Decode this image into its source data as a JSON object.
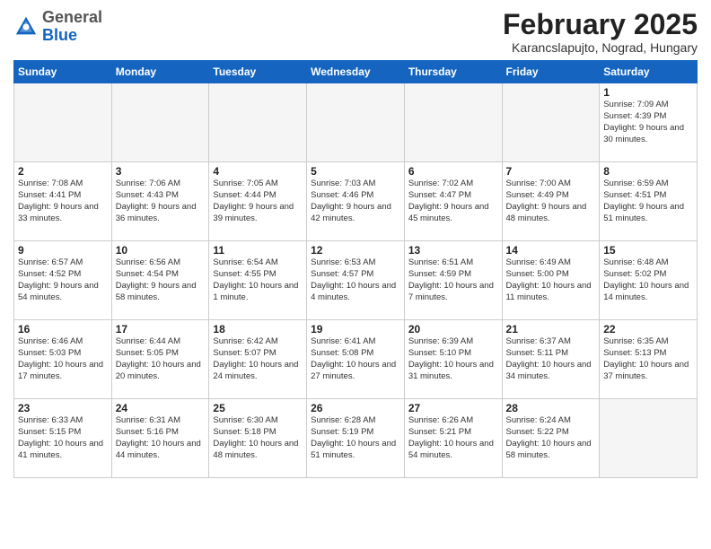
{
  "header": {
    "logo_general": "General",
    "logo_blue": "Blue",
    "month_title": "February 2025",
    "subtitle": "Karancslapujto, Nograd, Hungary"
  },
  "weekdays": [
    "Sunday",
    "Monday",
    "Tuesday",
    "Wednesday",
    "Thursday",
    "Friday",
    "Saturday"
  ],
  "weeks": [
    [
      {
        "day": "",
        "info": ""
      },
      {
        "day": "",
        "info": ""
      },
      {
        "day": "",
        "info": ""
      },
      {
        "day": "",
        "info": ""
      },
      {
        "day": "",
        "info": ""
      },
      {
        "day": "",
        "info": ""
      },
      {
        "day": "1",
        "info": "Sunrise: 7:09 AM\nSunset: 4:39 PM\nDaylight: 9 hours and 30 minutes."
      }
    ],
    [
      {
        "day": "2",
        "info": "Sunrise: 7:08 AM\nSunset: 4:41 PM\nDaylight: 9 hours and 33 minutes."
      },
      {
        "day": "3",
        "info": "Sunrise: 7:06 AM\nSunset: 4:43 PM\nDaylight: 9 hours and 36 minutes."
      },
      {
        "day": "4",
        "info": "Sunrise: 7:05 AM\nSunset: 4:44 PM\nDaylight: 9 hours and 39 minutes."
      },
      {
        "day": "5",
        "info": "Sunrise: 7:03 AM\nSunset: 4:46 PM\nDaylight: 9 hours and 42 minutes."
      },
      {
        "day": "6",
        "info": "Sunrise: 7:02 AM\nSunset: 4:47 PM\nDaylight: 9 hours and 45 minutes."
      },
      {
        "day": "7",
        "info": "Sunrise: 7:00 AM\nSunset: 4:49 PM\nDaylight: 9 hours and 48 minutes."
      },
      {
        "day": "8",
        "info": "Sunrise: 6:59 AM\nSunset: 4:51 PM\nDaylight: 9 hours and 51 minutes."
      }
    ],
    [
      {
        "day": "9",
        "info": "Sunrise: 6:57 AM\nSunset: 4:52 PM\nDaylight: 9 hours and 54 minutes."
      },
      {
        "day": "10",
        "info": "Sunrise: 6:56 AM\nSunset: 4:54 PM\nDaylight: 9 hours and 58 minutes."
      },
      {
        "day": "11",
        "info": "Sunrise: 6:54 AM\nSunset: 4:55 PM\nDaylight: 10 hours and 1 minute."
      },
      {
        "day": "12",
        "info": "Sunrise: 6:53 AM\nSunset: 4:57 PM\nDaylight: 10 hours and 4 minutes."
      },
      {
        "day": "13",
        "info": "Sunrise: 6:51 AM\nSunset: 4:59 PM\nDaylight: 10 hours and 7 minutes."
      },
      {
        "day": "14",
        "info": "Sunrise: 6:49 AM\nSunset: 5:00 PM\nDaylight: 10 hours and 11 minutes."
      },
      {
        "day": "15",
        "info": "Sunrise: 6:48 AM\nSunset: 5:02 PM\nDaylight: 10 hours and 14 minutes."
      }
    ],
    [
      {
        "day": "16",
        "info": "Sunrise: 6:46 AM\nSunset: 5:03 PM\nDaylight: 10 hours and 17 minutes."
      },
      {
        "day": "17",
        "info": "Sunrise: 6:44 AM\nSunset: 5:05 PM\nDaylight: 10 hours and 20 minutes."
      },
      {
        "day": "18",
        "info": "Sunrise: 6:42 AM\nSunset: 5:07 PM\nDaylight: 10 hours and 24 minutes."
      },
      {
        "day": "19",
        "info": "Sunrise: 6:41 AM\nSunset: 5:08 PM\nDaylight: 10 hours and 27 minutes."
      },
      {
        "day": "20",
        "info": "Sunrise: 6:39 AM\nSunset: 5:10 PM\nDaylight: 10 hours and 31 minutes."
      },
      {
        "day": "21",
        "info": "Sunrise: 6:37 AM\nSunset: 5:11 PM\nDaylight: 10 hours and 34 minutes."
      },
      {
        "day": "22",
        "info": "Sunrise: 6:35 AM\nSunset: 5:13 PM\nDaylight: 10 hours and 37 minutes."
      }
    ],
    [
      {
        "day": "23",
        "info": "Sunrise: 6:33 AM\nSunset: 5:15 PM\nDaylight: 10 hours and 41 minutes."
      },
      {
        "day": "24",
        "info": "Sunrise: 6:31 AM\nSunset: 5:16 PM\nDaylight: 10 hours and 44 minutes."
      },
      {
        "day": "25",
        "info": "Sunrise: 6:30 AM\nSunset: 5:18 PM\nDaylight: 10 hours and 48 minutes."
      },
      {
        "day": "26",
        "info": "Sunrise: 6:28 AM\nSunset: 5:19 PM\nDaylight: 10 hours and 51 minutes."
      },
      {
        "day": "27",
        "info": "Sunrise: 6:26 AM\nSunset: 5:21 PM\nDaylight: 10 hours and 54 minutes."
      },
      {
        "day": "28",
        "info": "Sunrise: 6:24 AM\nSunset: 5:22 PM\nDaylight: 10 hours and 58 minutes."
      },
      {
        "day": "",
        "info": ""
      }
    ]
  ]
}
